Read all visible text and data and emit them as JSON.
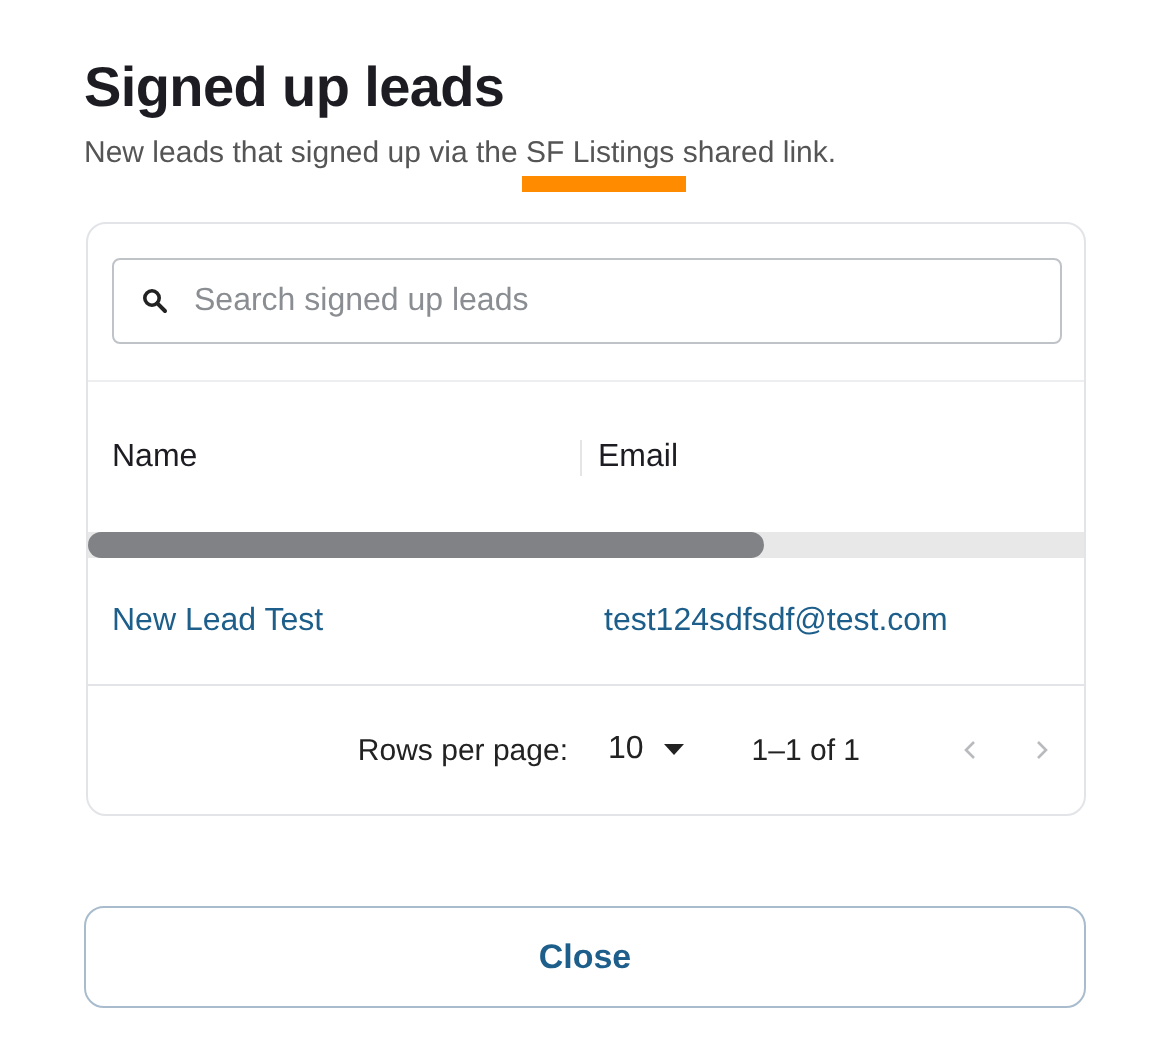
{
  "title": "Signed up leads",
  "subtitle": {
    "before": "New leads that signed up via the ",
    "highlight": "SF Listings",
    "after": " shared link.",
    "underlined": true
  },
  "search": {
    "placeholder": "Search signed up leads"
  },
  "table": {
    "columns": [
      "Name",
      "Email"
    ],
    "rows": [
      {
        "name": "New Lead Test",
        "email": "test124sdfsdf@test.com"
      }
    ]
  },
  "pagination": {
    "rows_per_page_label": "Rows per page:",
    "rows_per_page": "10",
    "range": "1–1 of 1",
    "prev_disabled": true,
    "next_disabled": true
  },
  "buttons": [
    "Close"
  ]
}
